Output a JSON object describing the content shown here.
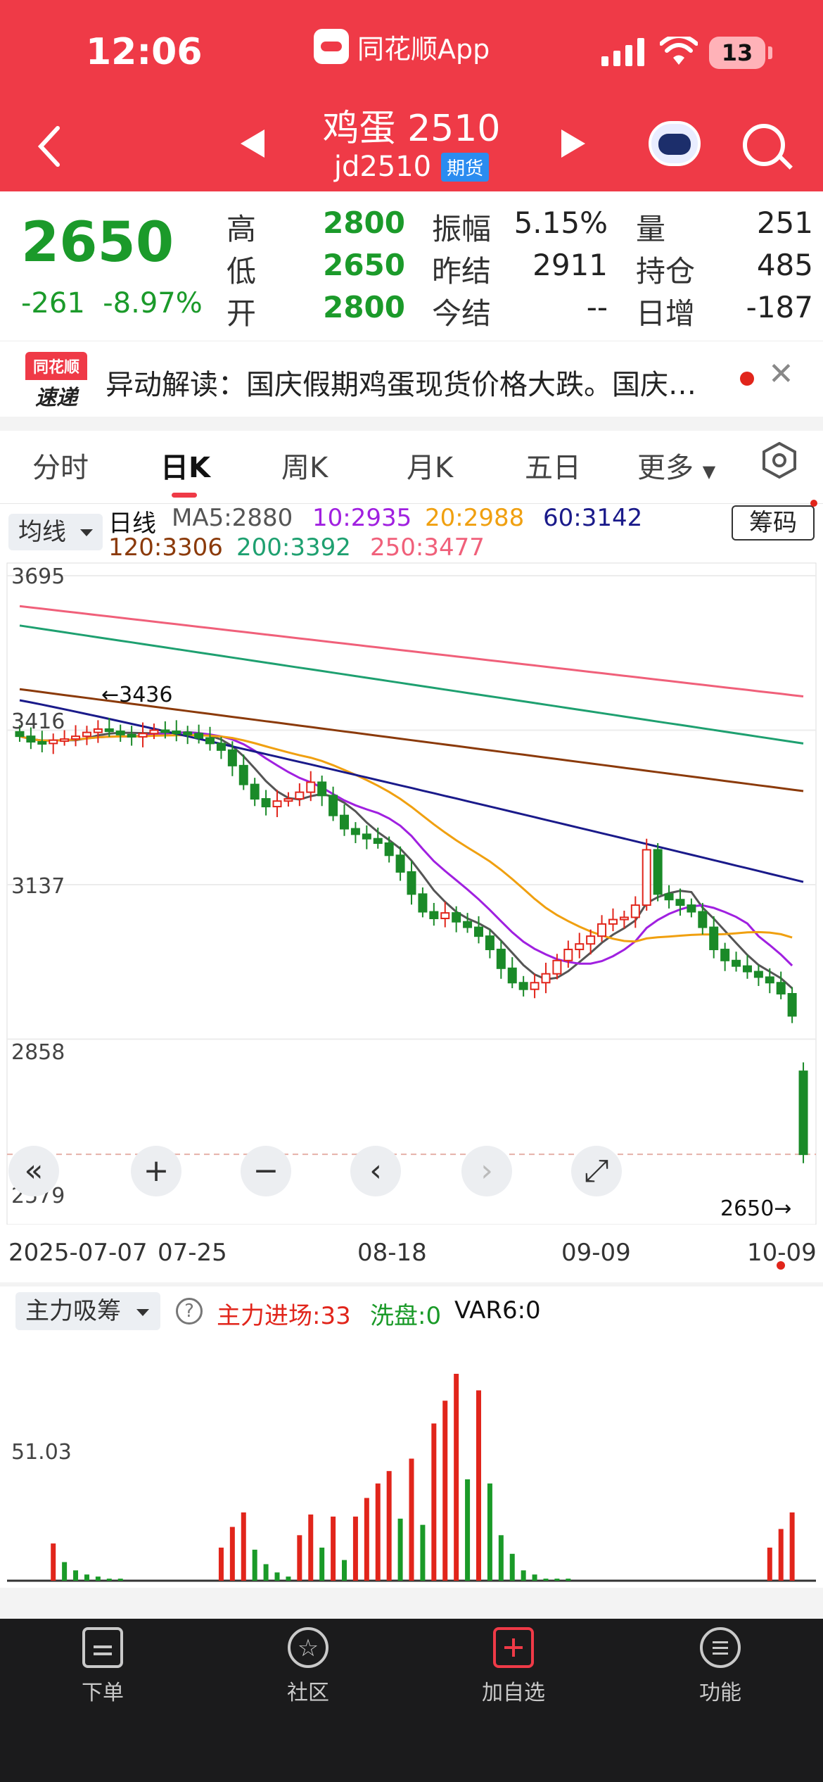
{
  "status": {
    "time": "12:06",
    "app_name": "同花顺App",
    "battery": "13"
  },
  "header": {
    "title": "鸡蛋 2510",
    "code": "jd2510",
    "badge": "期货"
  },
  "quote": {
    "price": "2650",
    "change": "-261",
    "change_pct": "-8.97%",
    "rows": [
      {
        "l1": "高",
        "v1": "2800",
        "l2": "振幅",
        "v2": "5.15%",
        "l3": "量",
        "v3": "251"
      },
      {
        "l1": "低",
        "v1": "2650",
        "l2": "昨结",
        "v2": "2911",
        "l3": "持仓",
        "v3": "485"
      },
      {
        "l1": "开",
        "v1": "2800",
        "l2": "今结",
        "v2": "--",
        "l3": "日增",
        "v3": "-187"
      }
    ]
  },
  "news": {
    "logo_top": "同花顺",
    "logo_bottom": "速递",
    "text": "异动解读：国庆假期鸡蛋现货价格大跌。国庆…"
  },
  "tabs": [
    "分时",
    "日K",
    "周K",
    "月K",
    "五日",
    "更多"
  ],
  "ma_panel": {
    "button": "均线",
    "line_label": "日线",
    "ma5": "MA5:2880",
    "ma10": "10:2935",
    "ma20": "20:2988",
    "ma60": "60:3142",
    "ma120": "120:3306",
    "ma200": "200:3392",
    "ma250": "250:3477",
    "chip_button": "筹码"
  },
  "chart_data": [
    {
      "type": "candlestick",
      "y_ticks": [
        "3695",
        "3416",
        "3137",
        "2858",
        "2579"
      ],
      "ylim": [
        2579,
        3695
      ],
      "x_ticks": [
        "2025-07-07",
        "07-25",
        "08-18",
        "09-09",
        "10-09"
      ],
      "annotations": {
        "high_marker": "←3436",
        "last_marker": "2650→"
      },
      "close": [
        3405,
        3395,
        3392,
        3398,
        3400,
        3405,
        3412,
        3418,
        3414,
        3408,
        3404,
        3410,
        3416,
        3414,
        3412,
        3410,
        3402,
        3392,
        3380,
        3352,
        3318,
        3292,
        3278,
        3288,
        3292,
        3304,
        3322,
        3298,
        3262,
        3238,
        3228,
        3220,
        3212,
        3190,
        3160,
        3120,
        3088,
        3076,
        3086,
        3070,
        3060,
        3044,
        3020,
        2986,
        2960,
        2948,
        2960,
        2976,
        3000,
        3020,
        3030,
        3044,
        3066,
        3074,
        3078,
        3100,
        3200,
        3120,
        3110,
        3100,
        3088,
        3060,
        3020,
        3000,
        2990,
        2980,
        2970,
        2960,
        2940,
        2900,
        2650
      ],
      "ma_values": {
        "MA5": 2880,
        "MA10": 2935,
        "MA20": 2988,
        "MA60": 3142,
        "MA120": 3306,
        "MA200": 3392,
        "MA250": 3477
      },
      "colors": {
        "up": "#e1251b",
        "down": "#1a8a28",
        "ma5": "#555555",
        "ma10": "#a020e0",
        "ma20": "#f0a010",
        "ma60": "#1a1a8a",
        "ma120": "#8b3a0a",
        "ma200": "#1ea070",
        "ma250": "#f0607a"
      }
    },
    {
      "type": "bar",
      "title": "主力吸筹",
      "y_ticks": [
        "51.03"
      ],
      "legend": [
        "主力进场:33",
        "洗盘:0",
        "VAR6:0"
      ],
      "values": [
        0,
        0,
        0,
        0,
        0,
        0,
        0,
        0,
        0,
        0,
        0,
        0,
        0,
        0,
        0,
        0,
        0,
        0,
        0,
        0,
        0,
        0,
        0,
        0,
        0,
        0,
        0,
        0,
        0,
        0,
        0,
        0,
        0,
        0,
        0,
        0,
        0,
        0,
        0,
        0,
        0,
        0,
        0,
        0,
        0,
        0,
        0,
        0,
        0,
        0,
        0,
        0,
        0,
        0,
        0,
        0,
        0,
        0,
        0,
        0,
        0,
        0,
        0,
        0,
        0,
        0,
        0,
        0,
        0,
        0,
        0
      ],
      "bars": [
        {
          "x": 3,
          "v": 18,
          "c": "r"
        },
        {
          "x": 4,
          "v": 9,
          "c": "g"
        },
        {
          "x": 5,
          "v": 5,
          "c": "g"
        },
        {
          "x": 6,
          "v": 3,
          "c": "g"
        },
        {
          "x": 7,
          "v": 2,
          "c": "g"
        },
        {
          "x": 8,
          "v": 1,
          "c": "g"
        },
        {
          "x": 9,
          "v": 1,
          "c": "g"
        },
        {
          "x": 18,
          "v": 16,
          "c": "r"
        },
        {
          "x": 19,
          "v": 26,
          "c": "r"
        },
        {
          "x": 20,
          "v": 33,
          "c": "r"
        },
        {
          "x": 21,
          "v": 15,
          "c": "g"
        },
        {
          "x": 22,
          "v": 8,
          "c": "g"
        },
        {
          "x": 23,
          "v": 4,
          "c": "g"
        },
        {
          "x": 24,
          "v": 2,
          "c": "g"
        },
        {
          "x": 25,
          "v": 22,
          "c": "r"
        },
        {
          "x": 26,
          "v": 32,
          "c": "r"
        },
        {
          "x": 27,
          "v": 16,
          "c": "g"
        },
        {
          "x": 28,
          "v": 31,
          "c": "r"
        },
        {
          "x": 29,
          "v": 10,
          "c": "g"
        },
        {
          "x": 30,
          "v": 31,
          "c": "r"
        },
        {
          "x": 31,
          "v": 40,
          "c": "r"
        },
        {
          "x": 32,
          "v": 47,
          "c": "r"
        },
        {
          "x": 33,
          "v": 53,
          "c": "r"
        },
        {
          "x": 34,
          "v": 30,
          "c": "g"
        },
        {
          "x": 35,
          "v": 59,
          "c": "r"
        },
        {
          "x": 36,
          "v": 27,
          "c": "g"
        },
        {
          "x": 37,
          "v": 76,
          "c": "r"
        },
        {
          "x": 38,
          "v": 87,
          "c": "r"
        },
        {
          "x": 39,
          "v": 100,
          "c": "r"
        },
        {
          "x": 40,
          "v": 49,
          "c": "g"
        },
        {
          "x": 41,
          "v": 92,
          "c": "r"
        },
        {
          "x": 42,
          "v": 47,
          "c": "g"
        },
        {
          "x": 43,
          "v": 22,
          "c": "g"
        },
        {
          "x": 44,
          "v": 13,
          "c": "g"
        },
        {
          "x": 45,
          "v": 5,
          "c": "g"
        },
        {
          "x": 46,
          "v": 3,
          "c": "g"
        },
        {
          "x": 47,
          "v": 1,
          "c": "g"
        },
        {
          "x": 48,
          "v": 1,
          "c": "g"
        },
        {
          "x": 49,
          "v": 1,
          "c": "g"
        },
        {
          "x": 67,
          "v": 16,
          "c": "r"
        },
        {
          "x": 68,
          "v": 25,
          "c": "r"
        },
        {
          "x": 69,
          "v": 33,
          "c": "r"
        }
      ]
    }
  ],
  "indicator": {
    "name": "主力吸筹",
    "help": "?",
    "main": "主力进场:33",
    "wash": "洗盘:0",
    "var6": "VAR6:0"
  },
  "tabbar": [
    "下单",
    "社区",
    "加自选",
    "功能"
  ]
}
